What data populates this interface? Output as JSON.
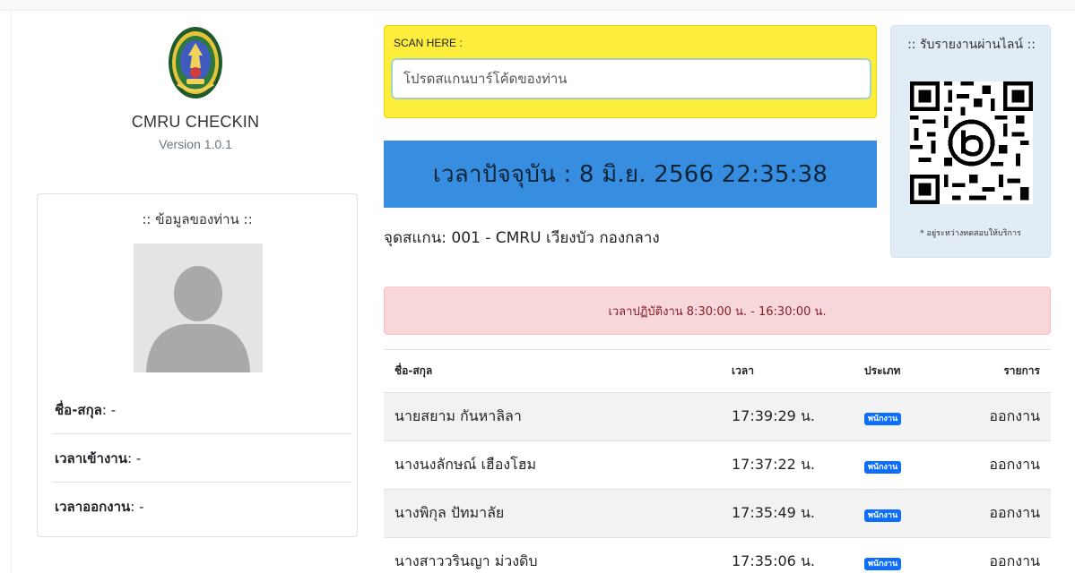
{
  "brand": {
    "name": "CMRU CHECKIN",
    "version": "Version 1.0.1",
    "logo_icon": "university-seal-icon"
  },
  "info": {
    "title": ":: ข้อมูลของท่าน ::",
    "avatar_icon": "user-placeholder-icon",
    "rows": [
      {
        "label": "ชื่อ-สกุล",
        "value": "-"
      },
      {
        "label": "เวลาเข้างาน",
        "value": "-"
      },
      {
        "label": "เวลาออกงาน",
        "value": "-"
      }
    ]
  },
  "scan": {
    "label": "SCAN HERE :",
    "placeholder": "โปรดสแกนบาร์โค้ดของท่าน",
    "value": ""
  },
  "clock": {
    "text": "เวลาปัจจุบัน : 8 มิ.ย. 2566 22:35:38"
  },
  "scan_point": {
    "text": "จุดสแกน: 001 - CMRU เวียงบัว กองกลาง"
  },
  "work_hours": {
    "text": "เวลาปฏิบัติงาน 8:30:00 น. - 16:30:00 น."
  },
  "line": {
    "title": ":: รับรายงานผ่านไลน์ ::",
    "qr_icon": "line-qr-code-icon",
    "note": "* อยู่ระหว่างทดสอบให้บริการ"
  },
  "table": {
    "headers": {
      "name": "ชื่อ-สกุล",
      "time": "เวลา",
      "type": "ประเภท",
      "action": "รายการ"
    },
    "rows": [
      {
        "name": "นายสยาม กันหาลิลา",
        "time": "17:39:29 น.",
        "type": "พนักงาน",
        "action": "ออกงาน"
      },
      {
        "name": "นางนงลักษณ์ เฮืองโฮม",
        "time": "17:37:22 น.",
        "type": "พนักงาน",
        "action": "ออกงาน"
      },
      {
        "name": "นางพิกุล ปัทมาลัย",
        "time": "17:35:49 น.",
        "type": "พนักงาน",
        "action": "ออกงาน"
      },
      {
        "name": "นางสาววรินญา ม่วงดิบ",
        "time": "17:35:06 น.",
        "type": "พนักงาน",
        "action": "ออกงาน"
      }
    ]
  },
  "colors": {
    "scan_bg": "#fcee3a",
    "clock_bg": "#378ee0",
    "alert_bg": "#f8d7da",
    "line_bg": "#e2ecf7",
    "badge": "#0d6efd"
  }
}
